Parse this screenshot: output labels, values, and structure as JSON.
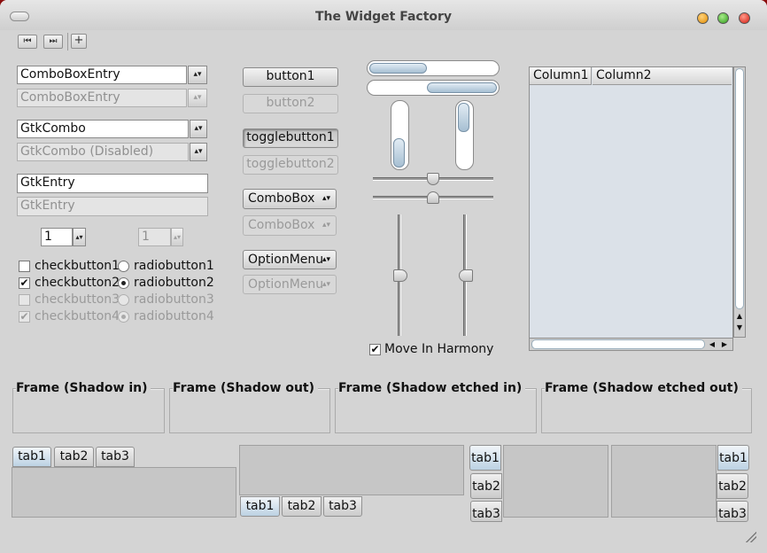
{
  "window": {
    "title": "The Widget Factory"
  },
  "toolbar": {
    "first_icon": "go-first-icon",
    "last_icon": "go-last-icon",
    "add_icon": "add-icon"
  },
  "entries": {
    "combo_entry_1": "ComboBoxEntry",
    "combo_entry_2": "ComboBoxEntry",
    "gtk_combo_1": "GtkCombo",
    "gtk_combo_2": "GtkCombo (Disabled)",
    "gtk_entry_1": "GtkEntry",
    "gtk_entry_2": "GtkEntry",
    "spin_1": "1",
    "spin_2": "1"
  },
  "checks": [
    {
      "label": "checkbutton1",
      "checked": false,
      "enabled": true
    },
    {
      "label": "checkbutton2",
      "checked": true,
      "enabled": true
    },
    {
      "label": "checkbutton3",
      "checked": false,
      "enabled": false
    },
    {
      "label": "checkbutton4",
      "checked": true,
      "enabled": false
    }
  ],
  "radios": [
    {
      "label": "radiobutton1",
      "selected": false,
      "enabled": true
    },
    {
      "label": "radiobutton2",
      "selected": true,
      "enabled": true
    },
    {
      "label": "radiobutton3",
      "selected": false,
      "enabled": false
    },
    {
      "label": "radiobutton4",
      "selected": true,
      "enabled": false
    }
  ],
  "buttons": {
    "button1": "button1",
    "button2": "button2",
    "toggle1": "togglebutton1",
    "toggle2": "togglebutton2",
    "combobox1": "ComboBox",
    "combobox2": "ComboBox",
    "optionmenu1": "OptionMenu",
    "optionmenu2": "OptionMenu"
  },
  "progress": {
    "h1": 0.45,
    "h2": 0.55,
    "v1": 0.45,
    "v2": 0.45
  },
  "scales": {
    "h1": 0.5,
    "h2": 0.5,
    "v1": 0.5,
    "v2": 0.5
  },
  "move_in_harmony": {
    "label": "Move In Harmony",
    "checked": true
  },
  "tree": {
    "columns": [
      "Column1",
      "Column2"
    ]
  },
  "frames": [
    "Frame (Shadow in)",
    "Frame (Shadow out)",
    "Frame (Shadow etched in)",
    "Frame (Shadow etched out)"
  ],
  "notebooks": {
    "top": [
      "tab1",
      "tab2",
      "tab3"
    ],
    "bottom": [
      "tab1",
      "tab2",
      "tab3"
    ],
    "left": [
      "tab1",
      "tab2",
      "tab3"
    ],
    "right": [
      "tab1",
      "tab2",
      "tab3"
    ]
  },
  "colors": {
    "desktop": "#8b0d0d",
    "window": "#d4d4d4",
    "accent": "#a6bfd2"
  }
}
